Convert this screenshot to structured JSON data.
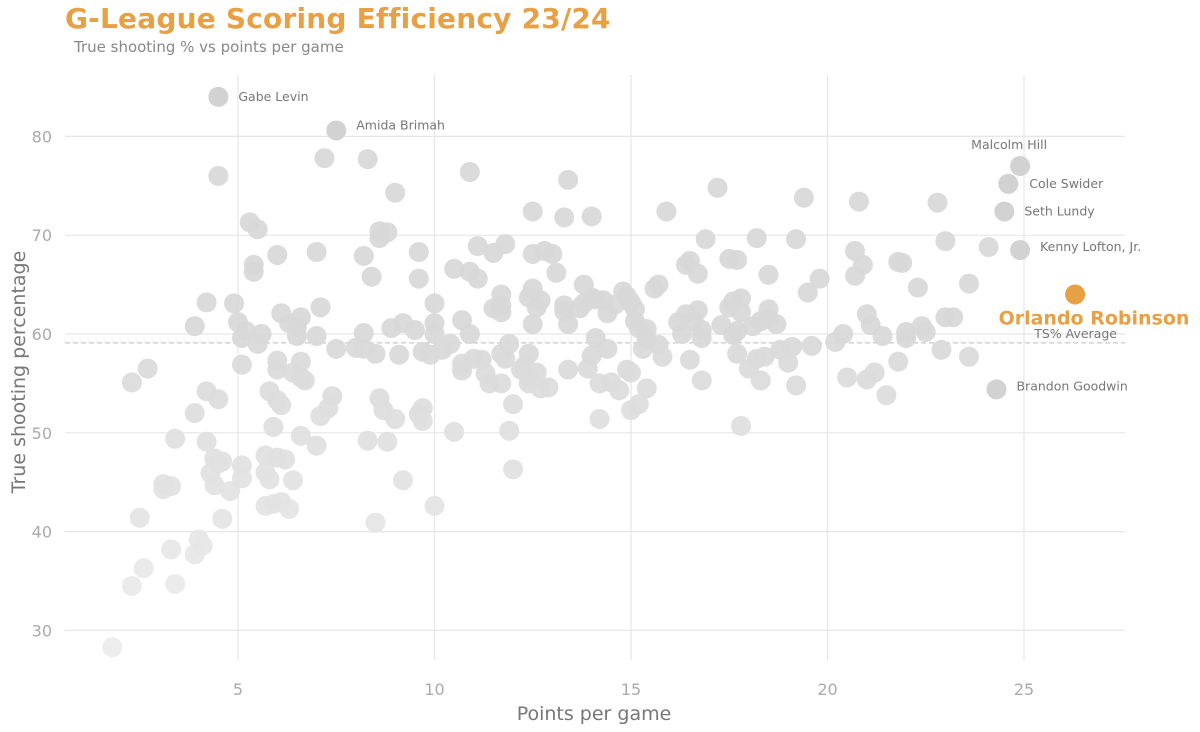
{
  "header": {
    "title": "G-League Scoring Efficiency 23/24",
    "subtitle": "True shooting % vs points per game"
  },
  "chart_data": {
    "type": "scatter",
    "title": "G-League Scoring Efficiency 23/24",
    "subtitle": "True shooting % vs points per game",
    "xlabel": "Points per game",
    "ylabel": "True shooting percentage",
    "xlim": [
      0.6,
      27.5
    ],
    "ylim": [
      25.5,
      87
    ],
    "xticks": [
      5,
      10,
      15,
      20,
      25
    ],
    "yticks": [
      30,
      40,
      50,
      60,
      70,
      80
    ],
    "grid": true,
    "colors": {
      "point": "#d4d4d4",
      "point_low": "#ececec",
      "highlight": "#E8A045",
      "grid": "#e6e6e6",
      "average_line": "#c8c8c8"
    },
    "average": {
      "label": "TS% Average",
      "value": 59.1
    },
    "highlight": {
      "name": "Orlando Robinson",
      "x": 26.3,
      "y": 64.0
    },
    "labeled_points": [
      {
        "name": "Gabe Levin",
        "x": 4.5,
        "y": 84.0
      },
      {
        "name": "Amida Brimah",
        "x": 7.5,
        "y": 80.6
      },
      {
        "name": "Malcolm Hill",
        "x": 24.9,
        "y": 77.0
      },
      {
        "name": "Cole Swider",
        "x": 24.6,
        "y": 75.2
      },
      {
        "name": "Seth Lundy",
        "x": 24.5,
        "y": 72.4
      },
      {
        "name": "Kenny Lofton, Jr.",
        "x": 24.9,
        "y": 68.5
      },
      {
        "name": "Brandon Goodwin",
        "x": 24.3,
        "y": 54.4
      }
    ],
    "points": [
      [
        1.8,
        28.3
      ],
      [
        2.3,
        34.5
      ],
      [
        2.6,
        36.3
      ],
      [
        3.4,
        34.7
      ],
      [
        3.3,
        38.2
      ],
      [
        3.9,
        37.7
      ],
      [
        4.0,
        39.2
      ],
      [
        4.1,
        38.6
      ],
      [
        2.5,
        41.4
      ],
      [
        3.1,
        44.8
      ],
      [
        3.1,
        44.3
      ],
      [
        3.3,
        44.6
      ],
      [
        4.6,
        41.3
      ],
      [
        4.8,
        44.1
      ],
      [
        4.3,
        45.9
      ],
      [
        4.4,
        44.7
      ],
      [
        4.5,
        46.9
      ],
      [
        4.4,
        47.4
      ],
      [
        4.6,
        47.1
      ],
      [
        5.1,
        46.7
      ],
      [
        5.1,
        45.4
      ],
      [
        4.2,
        49.1
      ],
      [
        3.4,
        49.4
      ],
      [
        3.9,
        52.0
      ],
      [
        4.5,
        53.4
      ],
      [
        4.2,
        54.2
      ],
      [
        2.3,
        55.1
      ],
      [
        2.7,
        56.5
      ],
      [
        5.7,
        42.6
      ],
      [
        5.9,
        42.8
      ],
      [
        6.1,
        43.0
      ],
      [
        6.3,
        42.3
      ],
      [
        6.4,
        45.2
      ],
      [
        5.7,
        46.0
      ],
      [
        5.8,
        45.3
      ],
      [
        5.7,
        47.7
      ],
      [
        6.0,
        47.5
      ],
      [
        6.2,
        47.3
      ],
      [
        6.6,
        49.7
      ],
      [
        7.0,
        48.7
      ],
      [
        5.9,
        50.6
      ],
      [
        6.0,
        53.3
      ],
      [
        6.1,
        52.8
      ],
      [
        5.8,
        54.2
      ],
      [
        6.0,
        56.4
      ],
      [
        6.0,
        57.3
      ],
      [
        6.4,
        56.1
      ],
      [
        6.6,
        55.6
      ],
      [
        6.7,
        55.3
      ],
      [
        6.6,
        57.2
      ],
      [
        7.1,
        51.7
      ],
      [
        7.3,
        52.5
      ],
      [
        7.4,
        53.7
      ],
      [
        7.5,
        58.5
      ],
      [
        8.0,
        58.6
      ],
      [
        8.2,
        58.5
      ],
      [
        8.3,
        49.2
      ],
      [
        8.8,
        49.1
      ],
      [
        8.5,
        40.9
      ],
      [
        9.2,
        45.2
      ],
      [
        8.6,
        53.5
      ],
      [
        8.7,
        52.3
      ],
      [
        9.0,
        51.4
      ],
      [
        9.6,
        51.9
      ],
      [
        9.7,
        52.5
      ],
      [
        9.7,
        51.2
      ],
      [
        10.0,
        42.6
      ],
      [
        9.1,
        57.9
      ],
      [
        8.5,
        58.0
      ],
      [
        8.9,
        60.6
      ],
      [
        9.2,
        61.1
      ],
      [
        8.2,
        60.1
      ],
      [
        5.1,
        56.9
      ],
      [
        5.1,
        59.6
      ],
      [
        5.2,
        60.3
      ],
      [
        5.5,
        59.0
      ],
      [
        5.6,
        60.0
      ],
      [
        5.0,
        61.2
      ],
      [
        4.9,
        63.1
      ],
      [
        4.2,
        63.2
      ],
      [
        3.9,
        60.8
      ],
      [
        6.1,
        62.1
      ],
      [
        6.3,
        61.1
      ],
      [
        6.5,
        60.7
      ],
      [
        6.6,
        61.7
      ],
      [
        6.5,
        59.8
      ],
      [
        7.0,
        59.8
      ],
      [
        7.1,
        62.7
      ],
      [
        5.4,
        66.3
      ],
      [
        5.4,
        67.0
      ],
      [
        5.5,
        70.6
      ],
      [
        5.3,
        71.3
      ],
      [
        6.0,
        68.0
      ],
      [
        7.0,
        68.3
      ],
      [
        8.2,
        67.9
      ],
      [
        8.4,
        65.8
      ],
      [
        8.6,
        69.7
      ],
      [
        8.6,
        70.4
      ],
      [
        8.8,
        70.3
      ],
      [
        7.2,
        77.8
      ],
      [
        8.3,
        77.7
      ],
      [
        9.0,
        74.3
      ],
      [
        4.5,
        76.0
      ],
      [
        9.6,
        68.3
      ],
      [
        9.6,
        65.6
      ],
      [
        10.5,
        66.6
      ],
      [
        10.9,
        66.3
      ],
      [
        11.1,
        65.6
      ],
      [
        11.1,
        68.9
      ],
      [
        11.5,
        68.2
      ],
      [
        11.8,
        69.1
      ],
      [
        10.9,
        76.4
      ],
      [
        9.5,
        60.4
      ],
      [
        9.7,
        58.2
      ],
      [
        9.9,
        57.9
      ],
      [
        10.0,
        60.0
      ],
      [
        10.0,
        61.1
      ],
      [
        10.0,
        63.1
      ],
      [
        10.2,
        58.4
      ],
      [
        10.4,
        59.0
      ],
      [
        10.7,
        61.4
      ],
      [
        10.9,
        60.0
      ],
      [
        10.7,
        57.0
      ],
      [
        10.7,
        56.3
      ],
      [
        11.0,
        57.5
      ],
      [
        11.2,
        57.4
      ],
      [
        11.3,
        56.0
      ],
      [
        11.4,
        55.0
      ],
      [
        11.7,
        55.0
      ],
      [
        11.9,
        59.0
      ],
      [
        11.7,
        58.0
      ],
      [
        11.8,
        57.5
      ],
      [
        11.5,
        62.6
      ],
      [
        11.7,
        62.9
      ],
      [
        11.7,
        64.0
      ],
      [
        11.7,
        62.2
      ],
      [
        10.5,
        50.1
      ],
      [
        11.9,
        50.2
      ],
      [
        12.0,
        52.9
      ],
      [
        12.0,
        46.3
      ],
      [
        12.2,
        56.4
      ],
      [
        12.3,
        56.8
      ],
      [
        12.4,
        55.6
      ],
      [
        12.4,
        55.0
      ],
      [
        12.6,
        56.1
      ],
      [
        12.4,
        58.0
      ],
      [
        12.7,
        54.5
      ],
      [
        12.9,
        54.6
      ],
      [
        12.5,
        61.0
      ],
      [
        12.6,
        62.7
      ],
      [
        12.4,
        63.7
      ],
      [
        12.5,
        64.6
      ],
      [
        12.7,
        63.4
      ],
      [
        12.5,
        68.1
      ],
      [
        12.8,
        68.4
      ],
      [
        13.0,
        68.1
      ],
      [
        13.1,
        66.2
      ],
      [
        13.3,
        62.3
      ],
      [
        13.4,
        61.0
      ],
      [
        13.3,
        62.9
      ],
      [
        13.4,
        56.4
      ],
      [
        13.9,
        56.5
      ],
      [
        14.0,
        57.8
      ],
      [
        14.1,
        59.6
      ],
      [
        14.2,
        55.0
      ],
      [
        14.2,
        51.4
      ],
      [
        14.4,
        58.5
      ],
      [
        14.5,
        55.1
      ],
      [
        14.7,
        54.3
      ],
      [
        14.4,
        62.1
      ],
      [
        14.3,
        63.4
      ],
      [
        14.1,
        63.5
      ],
      [
        14.0,
        63.7
      ],
      [
        13.8,
        63.1
      ],
      [
        13.7,
        62.6
      ],
      [
        13.8,
        65.0
      ],
      [
        14.6,
        63.0
      ],
      [
        14.8,
        64.3
      ],
      [
        14.9,
        63.8
      ],
      [
        15.0,
        63.2
      ],
      [
        15.1,
        62.5
      ],
      [
        15.1,
        61.3
      ],
      [
        15.2,
        60.6
      ],
      [
        15.4,
        60.5
      ],
      [
        15.4,
        59.5
      ],
      [
        15.0,
        52.3
      ],
      [
        15.2,
        52.9
      ],
      [
        15.4,
        54.5
      ],
      [
        14.9,
        56.4
      ],
      [
        15.0,
        56.1
      ],
      [
        15.3,
        58.5
      ],
      [
        15.7,
        58.9
      ],
      [
        15.8,
        57.7
      ],
      [
        15.6,
        64.6
      ],
      [
        15.7,
        65.0
      ],
      [
        15.9,
        72.4
      ],
      [
        13.4,
        75.6
      ],
      [
        13.3,
        71.8
      ],
      [
        14.0,
        71.9
      ],
      [
        12.5,
        72.4
      ],
      [
        16.2,
        61.2
      ],
      [
        16.4,
        62.0
      ],
      [
        16.3,
        60.0
      ],
      [
        16.5,
        57.4
      ],
      [
        16.6,
        61.3
      ],
      [
        16.7,
        62.4
      ],
      [
        16.8,
        60.4
      ],
      [
        16.8,
        59.6
      ],
      [
        16.8,
        55.3
      ],
      [
        16.4,
        67.0
      ],
      [
        16.5,
        67.4
      ],
      [
        16.7,
        66.1
      ],
      [
        16.9,
        69.6
      ],
      [
        17.2,
        74.8
      ],
      [
        17.3,
        60.9
      ],
      [
        17.5,
        62.7
      ],
      [
        17.6,
        59.9
      ],
      [
        17.7,
        60.3
      ],
      [
        17.7,
        58.0
      ],
      [
        17.8,
        50.7
      ],
      [
        17.6,
        63.3
      ],
      [
        17.8,
        63.6
      ],
      [
        17.8,
        62.2
      ],
      [
        17.5,
        67.6
      ],
      [
        17.7,
        67.5
      ],
      [
        18.2,
        69.7
      ],
      [
        18.0,
        56.5
      ],
      [
        18.3,
        55.3
      ],
      [
        18.2,
        57.5
      ],
      [
        18.4,
        57.7
      ],
      [
        18.1,
        60.8
      ],
      [
        18.3,
        61.3
      ],
      [
        18.5,
        61.6
      ],
      [
        18.5,
        62.5
      ],
      [
        18.7,
        61.0
      ],
      [
        18.5,
        66.0
      ],
      [
        18.8,
        58.4
      ],
      [
        19.0,
        57.1
      ],
      [
        19.1,
        58.7
      ],
      [
        19.2,
        54.8
      ],
      [
        19.2,
        69.6
      ],
      [
        19.4,
        73.8
      ],
      [
        19.5,
        64.2
      ],
      [
        19.8,
        65.6
      ],
      [
        19.6,
        58.8
      ],
      [
        20.2,
        59.2
      ],
      [
        20.4,
        60.0
      ],
      [
        20.5,
        55.6
      ],
      [
        20.8,
        73.4
      ],
      [
        20.7,
        68.4
      ],
      [
        20.7,
        65.9
      ],
      [
        20.9,
        67.0
      ],
      [
        21.0,
        62.0
      ],
      [
        21.1,
        60.9
      ],
      [
        21.4,
        59.8
      ],
      [
        21.2,
        56.1
      ],
      [
        21.0,
        55.4
      ],
      [
        21.5,
        53.8
      ],
      [
        21.8,
        57.2
      ],
      [
        21.8,
        67.3
      ],
      [
        21.9,
        67.2
      ],
      [
        22.0,
        59.6
      ],
      [
        22.0,
        60.2
      ],
      [
        22.3,
        64.7
      ],
      [
        22.4,
        60.8
      ],
      [
        22.5,
        60.2
      ],
      [
        22.8,
        73.3
      ],
      [
        23.0,
        69.4
      ],
      [
        22.9,
        58.4
      ],
      [
        23.0,
        61.7
      ],
      [
        23.2,
        61.7
      ],
      [
        23.6,
        65.1
      ],
      [
        23.6,
        57.7
      ],
      [
        24.1,
        68.8
      ]
    ]
  }
}
